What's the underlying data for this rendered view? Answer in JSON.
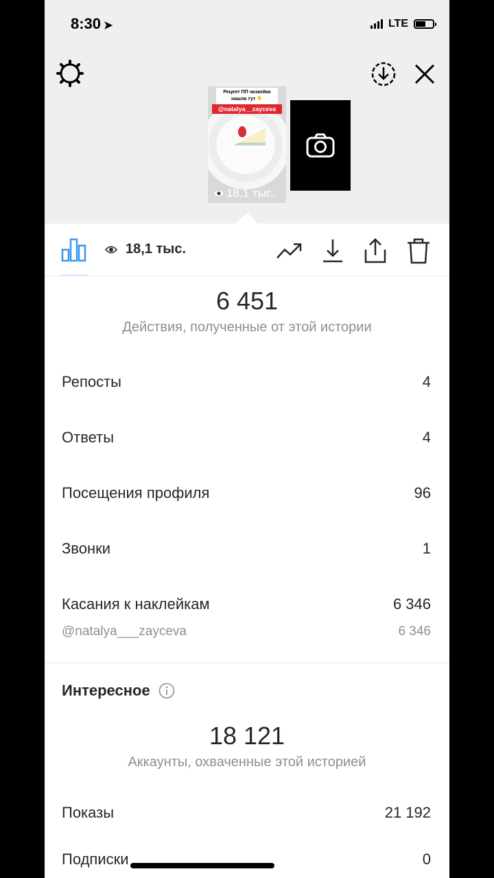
{
  "status_bar": {
    "time": "8:30",
    "network": "LTE"
  },
  "story": {
    "caption": "Рецепт ПП чизкейка нашла тут 👇",
    "mention": "@natalya__zayceva",
    "views": "18,1 тыс."
  },
  "toolbar": {
    "views": "18,1 тыс."
  },
  "actions": {
    "total": "6 451",
    "caption": "Действия, полученные от этой истории",
    "rows": [
      {
        "label": "Репосты",
        "value": "4"
      },
      {
        "label": "Ответы",
        "value": "4"
      },
      {
        "label": "Посещения профиля",
        "value": "96"
      },
      {
        "label": "Звонки",
        "value": "1"
      },
      {
        "label": "Касания к наклейкам",
        "value": "6 346"
      }
    ],
    "sticker": {
      "label": "@natalya___zayceva",
      "value": "6 346"
    }
  },
  "discovery": {
    "title": "Интересное",
    "total": "18 121",
    "caption": "Аккаунты, охваченные этой историей",
    "rows": [
      {
        "label": "Показы",
        "value": "21 192"
      },
      {
        "label": "Подписки",
        "value": "0"
      }
    ]
  },
  "colors": {
    "accent": "#3897f0",
    "text": "#262626",
    "secondary": "#8e8e8e",
    "mention_bg": "#e0262f"
  }
}
